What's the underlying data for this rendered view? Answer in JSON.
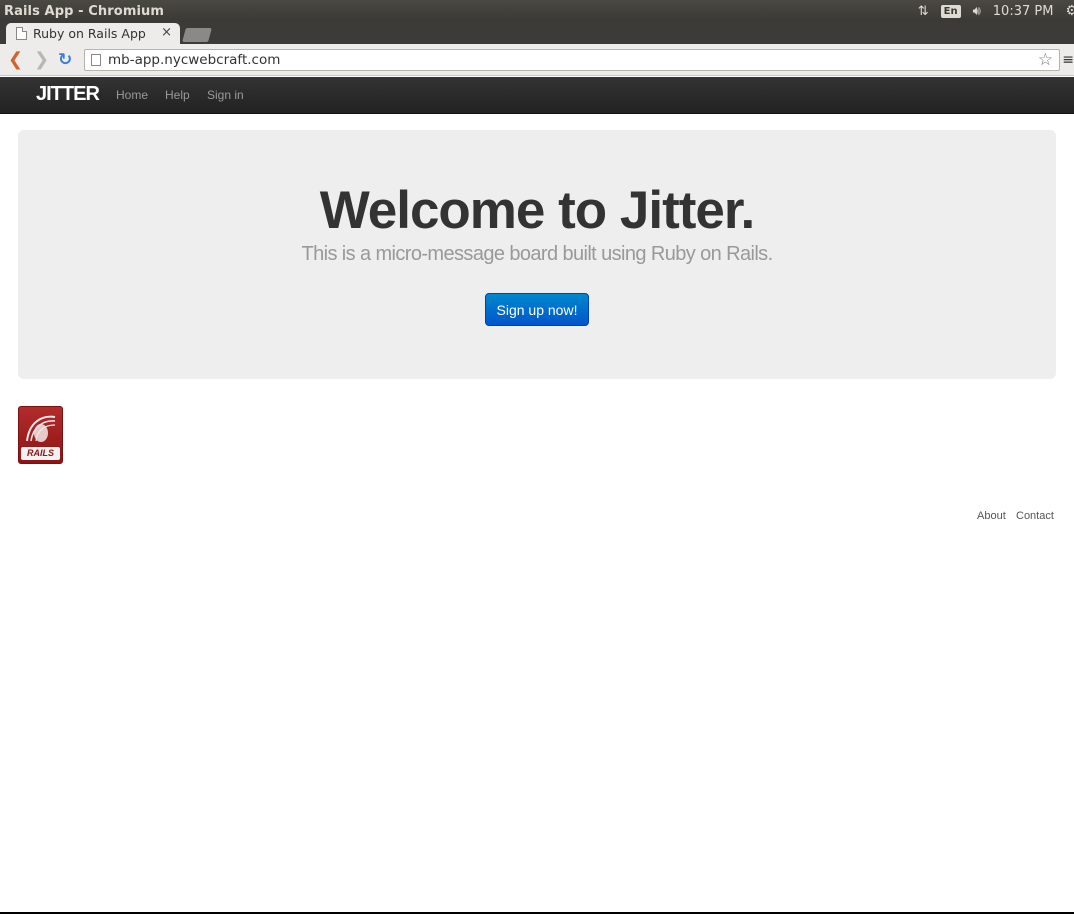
{
  "os_panel": {
    "window_title": "Rails App - Chromium",
    "keyboard_layout": "En",
    "time": "10:37 PM"
  },
  "browser": {
    "tab_title": "Ruby on Rails App",
    "tab_close": "×",
    "url": "mb-app.nycwebcraft.com"
  },
  "navbar": {
    "brand": "JITTER",
    "links": [
      "Home",
      "Help",
      "Sign in"
    ]
  },
  "hero": {
    "title": "Welcome to Jitter.",
    "subtitle": "This is a micro-message board built using Ruby on Rails.",
    "cta_label": "Sign up now!"
  },
  "logo": {
    "text": "RAILS",
    "brand_color": "#a31f1f"
  },
  "footer": {
    "links": [
      "About",
      "Contact"
    ]
  },
  "colors": {
    "accent": "#0069d9",
    "navbar_bg": "#222222",
    "hero_bg": "#eeeeee"
  }
}
